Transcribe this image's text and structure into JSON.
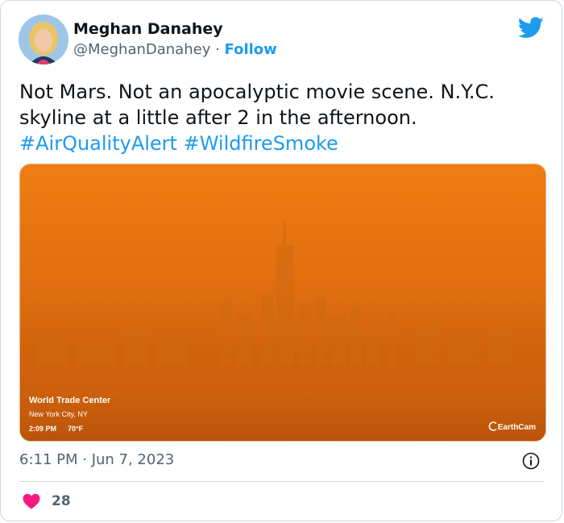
{
  "author": {
    "name": "Meghan Danahey",
    "handle": "@MeghanDanahey",
    "separator": " · ",
    "follow_label": "Follow"
  },
  "tweet": {
    "text": "Not Mars. Not an apocalyptic movie scene. N.Y.C. skyline at a little after 2 in the afternoon.",
    "hashtags": [
      "#AirQualityAlert",
      "#WildfireSmoke"
    ],
    "timestamp": "6:11 PM · Jun 7, 2023",
    "like_count": "28"
  },
  "media": {
    "location": "World Trade Center",
    "city": "New York City, NY",
    "time": "2:09 PM",
    "temperature": "70°F",
    "watermark": "EarthCam"
  },
  "colors": {
    "link": "#1d9bf0",
    "heart": "#f91880",
    "secondary_text": "#536471",
    "sky": "#f07c12"
  },
  "icons": [
    "twitter-bird-icon",
    "info-icon",
    "heart-icon",
    "earthcam-logo-icon"
  ]
}
